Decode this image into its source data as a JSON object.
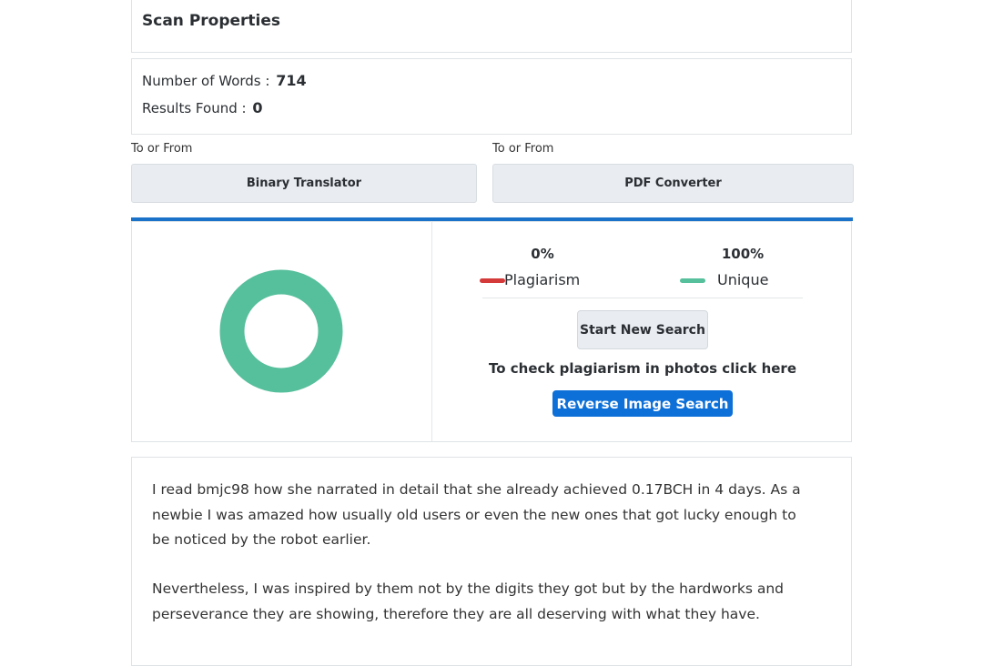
{
  "scan_properties": {
    "title": "Scan Properties"
  },
  "stats": {
    "words_label": "Number of Words :",
    "words_value": "714",
    "results_label": "Results Found :",
    "results_value": "0"
  },
  "tools": [
    {
      "label": "To or From",
      "button": "Binary Translator"
    },
    {
      "label": "To or From",
      "button": "PDF Converter"
    }
  ],
  "result": {
    "plagiarism_pct": "0%",
    "plagiarism_label": "Plagiarism",
    "unique_pct": "100%",
    "unique_label": "Unique",
    "plagiarism_fraction": 0.0,
    "unique_fraction": 1.0,
    "colors": {
      "plagiarism": "#d43a3a",
      "unique": "#56bf9b"
    },
    "start_button": "Start New Search",
    "photo_note": "To check plagiarism in photos click here",
    "reverse_button": "Reverse Image Search"
  },
  "text": {
    "paragraphs": [
      "I read bmjc98 how she narrated in detail that she already achieved 0.17BCH in 4 days. As a newbie I was amazed how usually old users or even the new ones that got lucky enough to be noticed by the robot earlier.",
      "Nevertheless, I was inspired by them not by the digits they got but by the hardworks and perseverance they are showing, therefore they are all deserving with what they have."
    ]
  }
}
